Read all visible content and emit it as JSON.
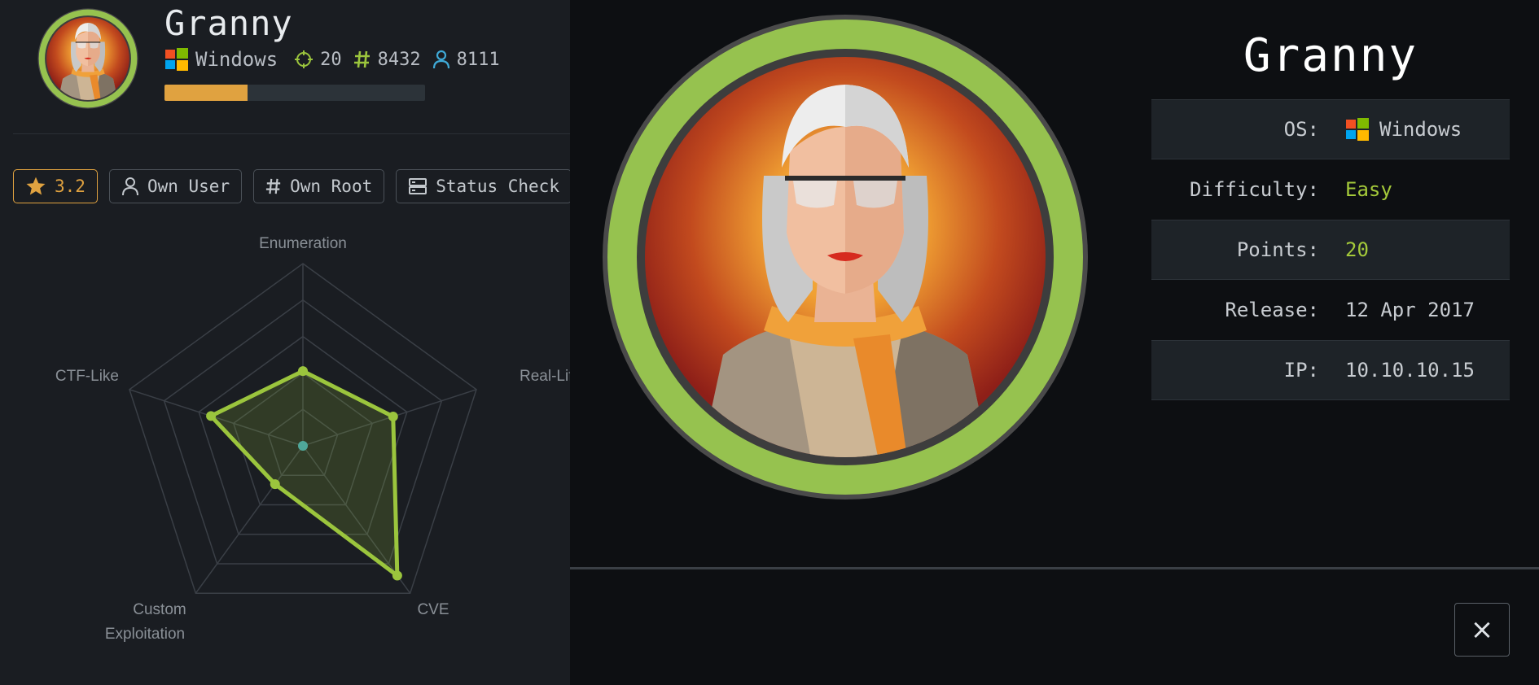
{
  "machine": {
    "name": "Granny",
    "os": "Windows",
    "points": "20",
    "owns_root": "8432",
    "owns_user": "8111",
    "progress_fraction": 0.32
  },
  "actions": {
    "rating": "3.2",
    "own_user": "Own User",
    "own_root": "Own Root",
    "status_check": "Status Check"
  },
  "radar": {
    "labels": {
      "enumeration": "Enumeration",
      "real_life": "Real-Life",
      "cve": "CVE",
      "custom_line1": "Custom",
      "custom_line2": "Exploitation",
      "ctf_like": "CTF-Like"
    }
  },
  "chart_data": {
    "type": "radar",
    "axes": [
      "Enumeration",
      "Real-Life",
      "CVE",
      "Custom Exploitation",
      "CTF-Like"
    ],
    "values": [
      4.1,
      5.2,
      8.8,
      2.6,
      5.3
    ],
    "max": 10
  },
  "detail": {
    "title": "Granny",
    "rows": [
      {
        "label": "OS:",
        "value": "Windows"
      },
      {
        "label": "Difficulty:",
        "value": "Easy"
      },
      {
        "label": "Points:",
        "value": "20"
      },
      {
        "label": "Release:",
        "value": "12 Apr 2017"
      },
      {
        "label": "IP:",
        "value": "10.10.10.15"
      }
    ]
  },
  "colors": {
    "accent_green": "#9bc53d",
    "difficulty_easy": "#a4c93a",
    "rating_orange": "#e0a240",
    "background": "#0d0f12"
  },
  "icons": {
    "os": "windows-logo-icon",
    "points": "crosshair-icon",
    "root": "hash-icon",
    "user": "user-icon",
    "close": "close-icon"
  },
  "close_label": "×"
}
